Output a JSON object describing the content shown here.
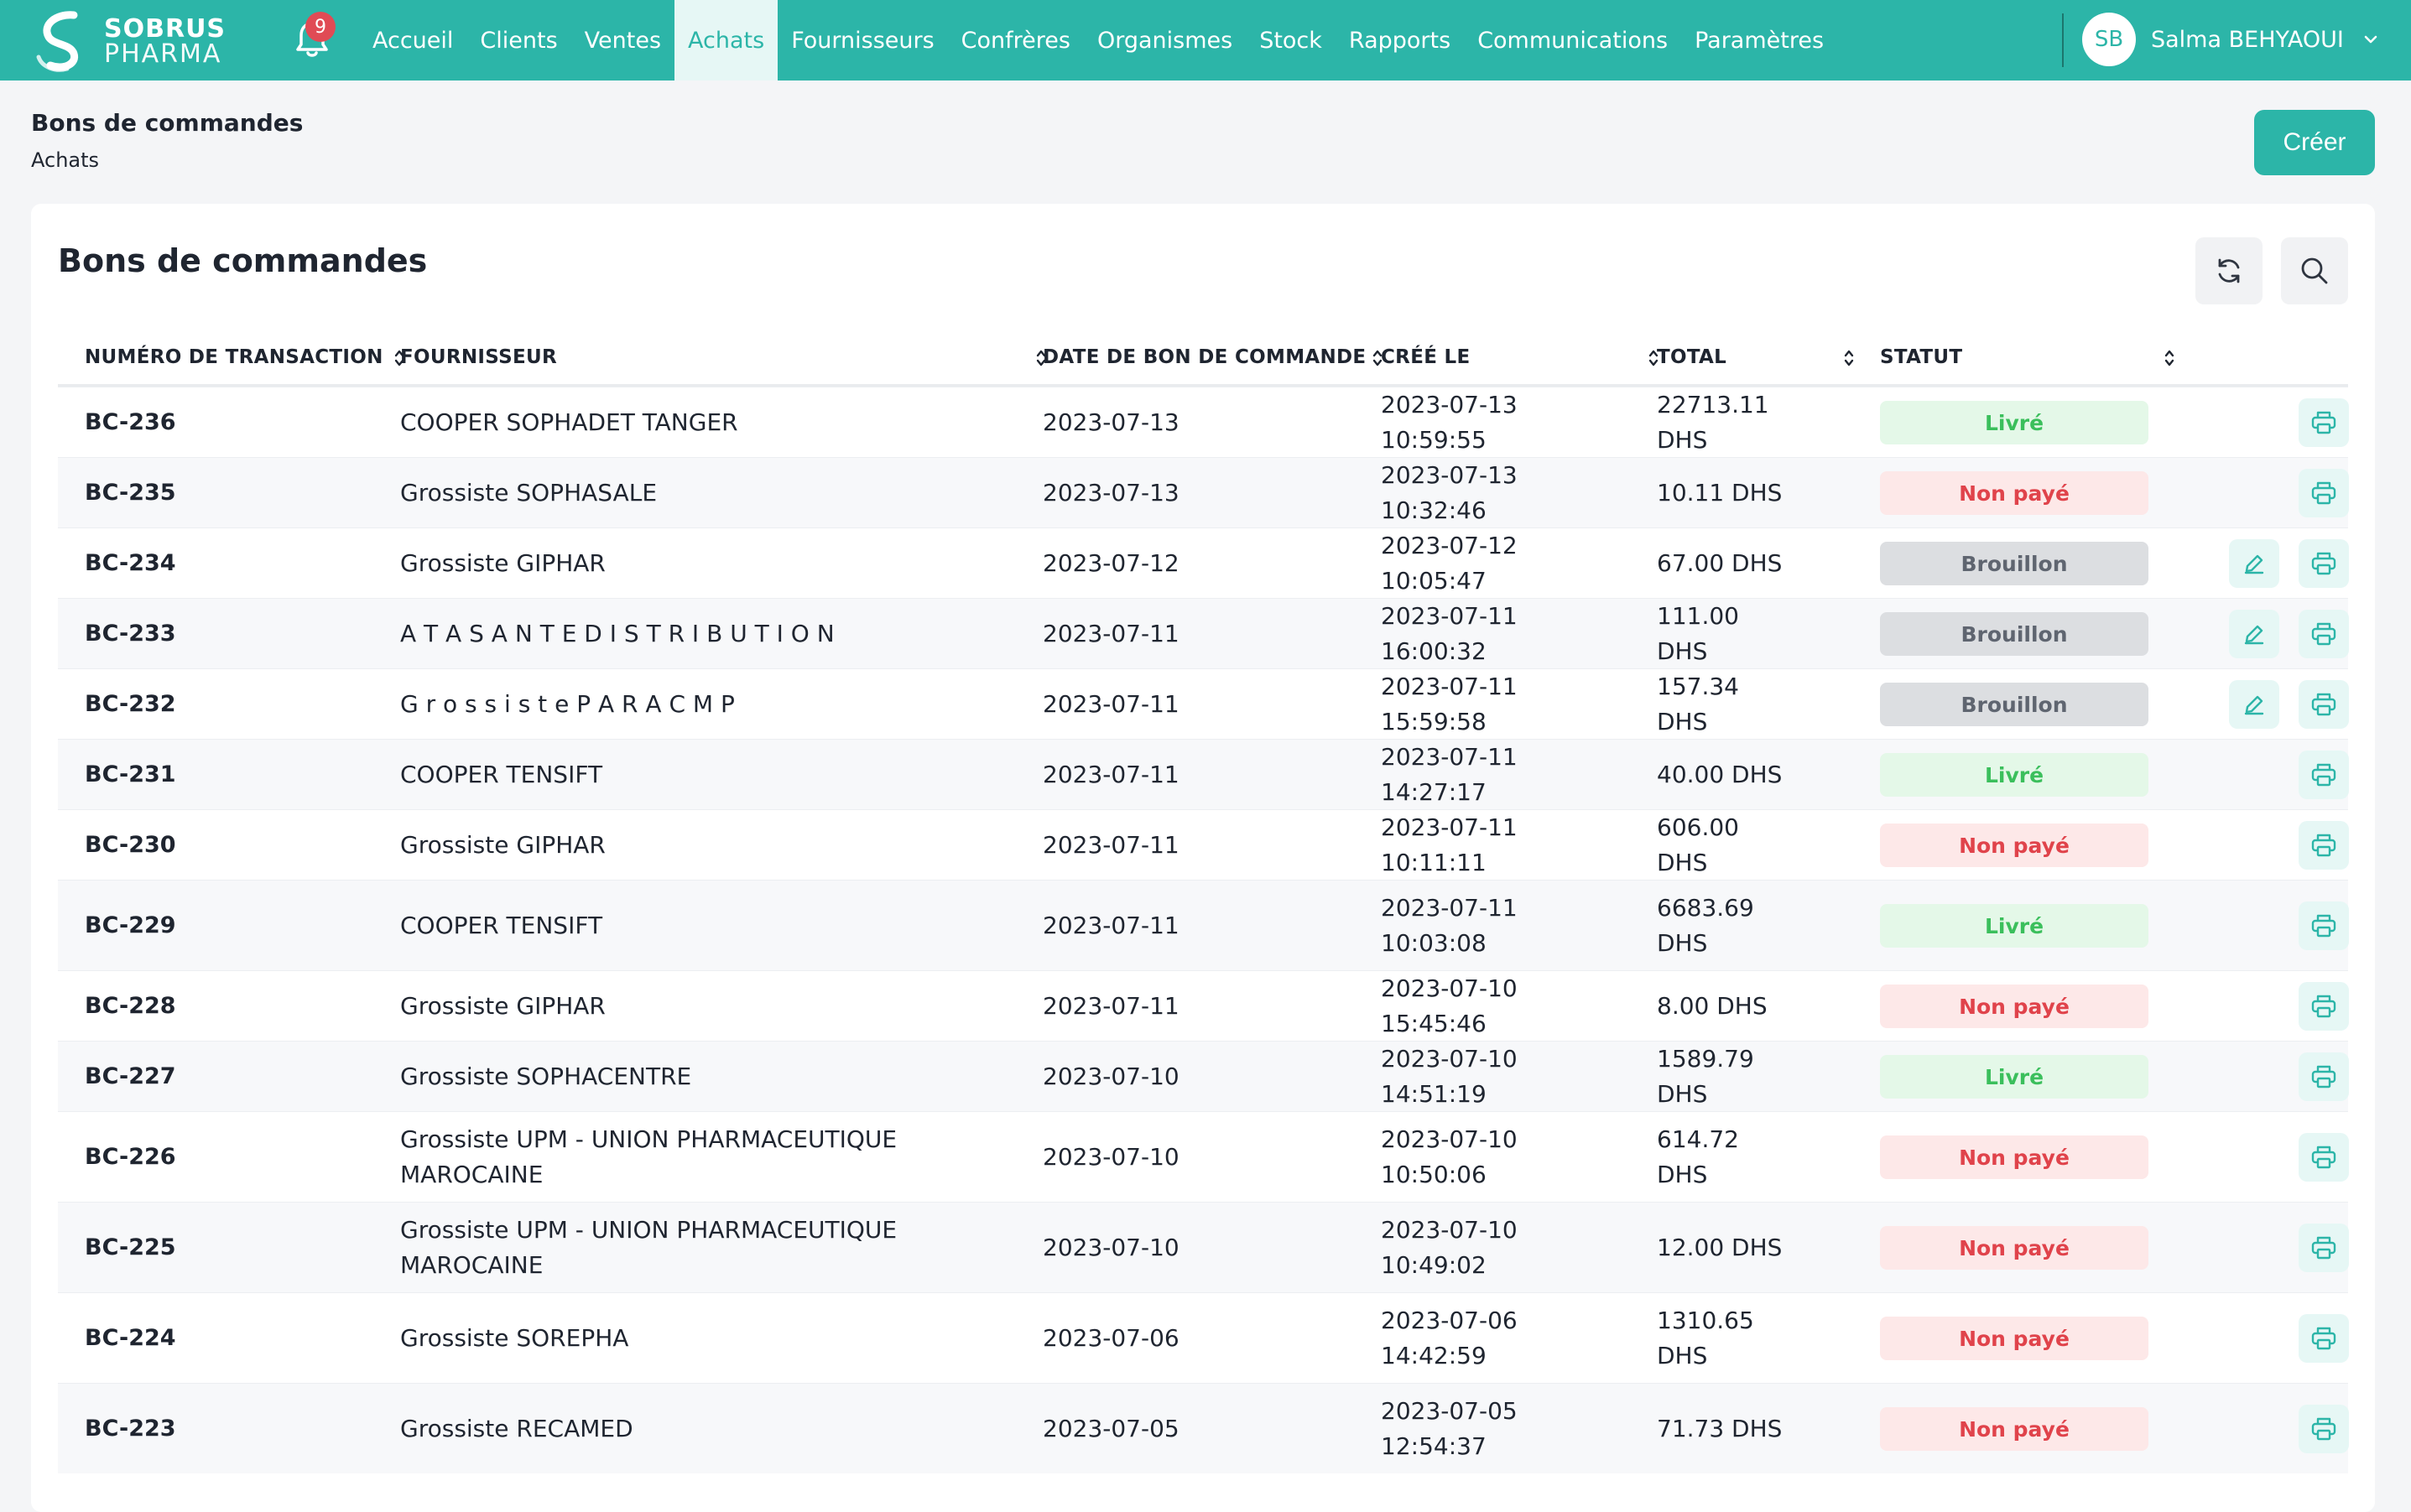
{
  "app": {
    "logo_line1": "SOBRUS",
    "logo_line2": "PHARMA",
    "notification_count": "9",
    "nav": [
      "Accueil",
      "Clients",
      "Ventes",
      "Achats",
      "Fournisseurs",
      "Confrères",
      "Organismes",
      "Stock",
      "Rapports",
      "Communications",
      "Paramètres"
    ],
    "active_nav": "Achats",
    "user_initials": "SB",
    "user_name": "Salma BEHYAOUI",
    "colors": {
      "brand": "#2cb5a8",
      "livre": "#3bbf5c",
      "non_paye": "#e0434b",
      "brouillon": "#5f6570"
    }
  },
  "page": {
    "title": "Bons de commandes",
    "breadcrumb": "Achats",
    "create_label": "Créer"
  },
  "card": {
    "title": "Bons de commandes",
    "refresh_icon": "refresh-icon",
    "search_icon": "search-icon"
  },
  "table": {
    "columns": [
      "NUMÉRO DE TRANSACTION",
      "FOURNISSEUR",
      "DATE DE BON DE COMMANDE",
      "CRÉÉ LE",
      "TOTAL",
      "STATUT"
    ],
    "rows": [
      {
        "num": "BC-236",
        "fournisseur": "COOPER SOPHADET TANGER",
        "date": "2023-07-13",
        "cree": "2023-07-13 10:59:55",
        "total": "22713.11 DHS",
        "statut": "Livré",
        "editable": false
      },
      {
        "num": "BC-235",
        "fournisseur": "Grossiste SOPHASALE",
        "date": "2023-07-13",
        "cree": "2023-07-13 10:32:46",
        "total": "10.11 DHS",
        "statut": "Non payé",
        "editable": false
      },
      {
        "num": "BC-234",
        "fournisseur": "Grossiste GIPHAR",
        "date": "2023-07-12",
        "cree": "2023-07-12 10:05:47",
        "total": "67.00 DHS",
        "statut": "Brouillon",
        "editable": true
      },
      {
        "num": "BC-233",
        "fournisseur": "A T A S A N T E D I S T R I B U T I O N",
        "date": "2023-07-11",
        "cree": "2023-07-11 16:00:32",
        "total": "111.00 DHS",
        "statut": "Brouillon",
        "editable": true
      },
      {
        "num": "BC-232",
        "fournisseur": "G r o s s i s t e P A R A C M P",
        "date": "2023-07-11",
        "cree": "2023-07-11 15:59:58",
        "total": "157.34 DHS",
        "statut": "Brouillon",
        "editable": true
      },
      {
        "num": "BC-231",
        "fournisseur": "COOPER TENSIFT",
        "date": "2023-07-11",
        "cree": "2023-07-11 14:27:17",
        "total": "40.00 DHS",
        "statut": "Livré",
        "editable": false
      },
      {
        "num": "BC-230",
        "fournisseur": "Grossiste GIPHAR",
        "date": "2023-07-11",
        "cree": "2023-07-11 10:11:11",
        "total": "606.00 DHS",
        "statut": "Non payé",
        "editable": false
      },
      {
        "num": "BC-229",
        "fournisseur": "COOPER TENSIFT",
        "date": "2023-07-11",
        "cree": "2023-07-11 10:03:08",
        "total": "6683.69 DHS",
        "statut": "Livré",
        "editable": false
      },
      {
        "num": "BC-228",
        "fournisseur": "Grossiste GIPHAR",
        "date": "2023-07-11",
        "cree": "2023-07-10 15:45:46",
        "total": "8.00 DHS",
        "statut": "Non payé",
        "editable": false
      },
      {
        "num": "BC-227",
        "fournisseur": "Grossiste SOPHACENTRE",
        "date": "2023-07-10",
        "cree": "2023-07-10 14:51:19",
        "total": "1589.79 DHS",
        "statut": "Livré",
        "editable": false
      },
      {
        "num": "BC-226",
        "fournisseur": "Grossiste UPM - UNION PHARMACEUTIQUE MAROCAINE",
        "date": "2023-07-10",
        "cree": "2023-07-10 10:50:06",
        "total": "614.72 DHS",
        "statut": "Non payé",
        "editable": false
      },
      {
        "num": "BC-225",
        "fournisseur": "Grossiste UPM - UNION PHARMACEUTIQUE MAROCAINE",
        "date": "2023-07-10",
        "cree": "2023-07-10 10:49:02",
        "total": "12.00 DHS",
        "statut": "Non payé",
        "editable": false
      },
      {
        "num": "BC-224",
        "fournisseur": "Grossiste SOREPHA",
        "date": "2023-07-06",
        "cree": "2023-07-06 14:42:59",
        "total": "1310.65 DHS",
        "statut": "Non payé",
        "editable": false
      },
      {
        "num": "BC-223",
        "fournisseur": "Grossiste RECAMED",
        "date": "2023-07-05",
        "cree": "2023-07-05 12:54:37",
        "total": "71.73 DHS",
        "statut": "Non payé",
        "editable": false
      }
    ]
  }
}
